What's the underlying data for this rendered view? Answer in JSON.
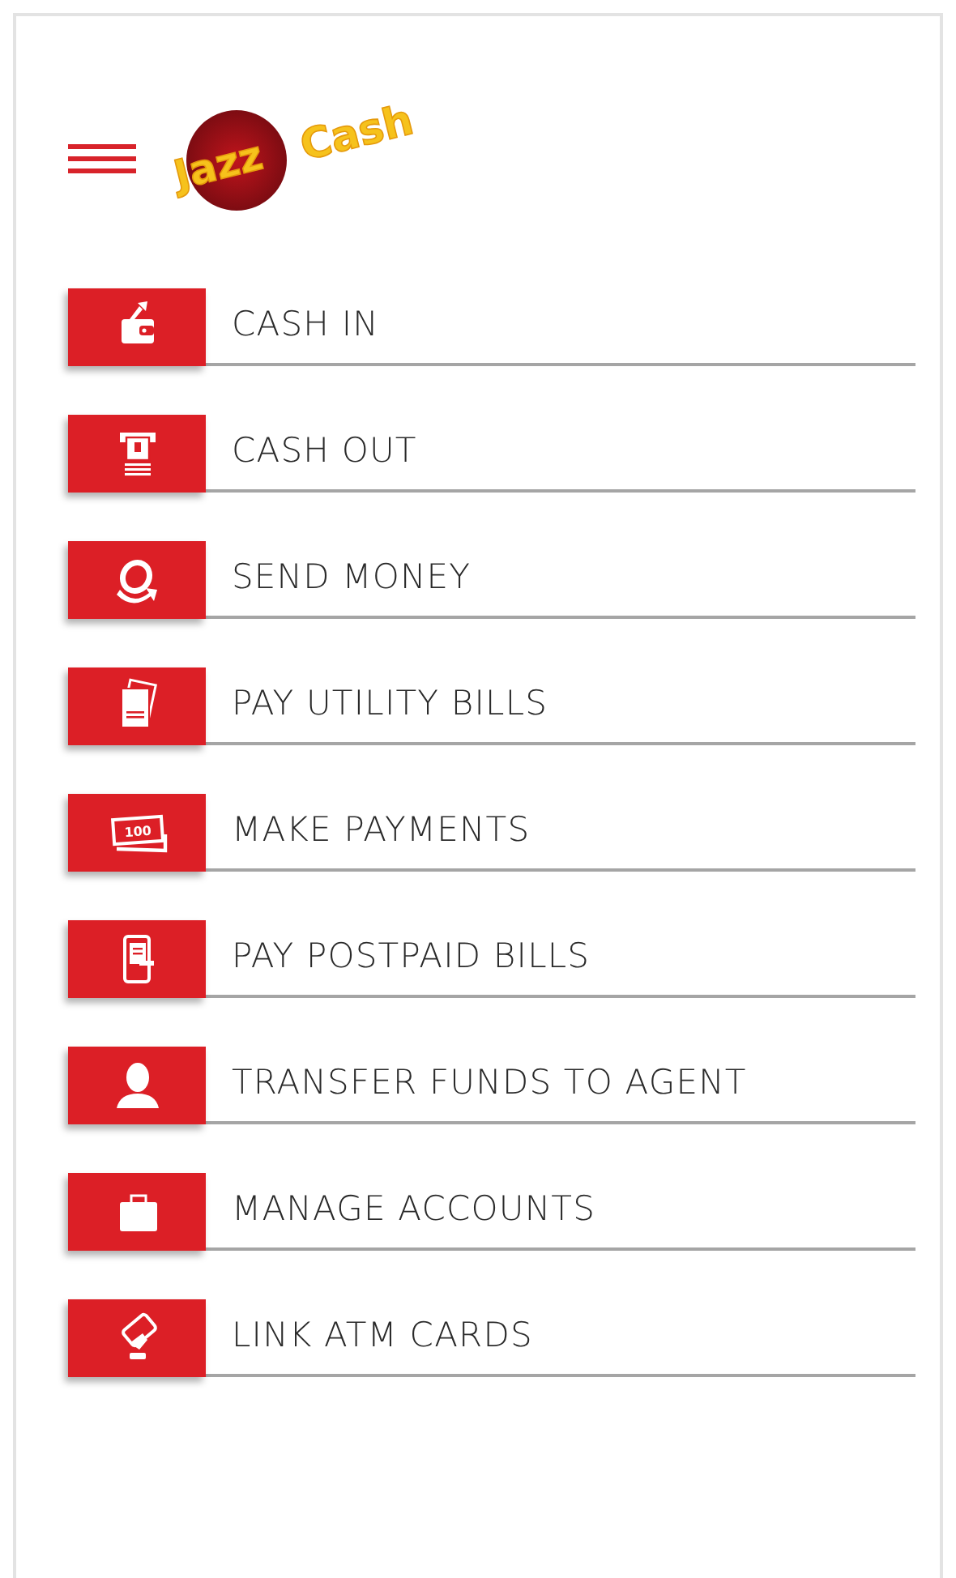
{
  "header": {
    "logo": {
      "part_1": "Jazz",
      "part_2": "Cash"
    }
  },
  "menu": [
    {
      "kind": "wallet",
      "label": "CASH IN"
    },
    {
      "kind": "atm",
      "label": "CASH OUT"
    },
    {
      "kind": "send",
      "label": "SEND MONEY"
    },
    {
      "kind": "bills",
      "label": "PAY UTILITY BILLS"
    },
    {
      "kind": "banknote",
      "label": "MAKE PAYMENTS",
      "icon_text": "100"
    },
    {
      "kind": "phone",
      "label": "PAY POSTPAID BILLS"
    },
    {
      "kind": "person",
      "label": "TRANSFER FUNDS TO AGENT"
    },
    {
      "kind": "briefcase",
      "label": "MANAGE ACCOUNTS"
    },
    {
      "kind": "card",
      "label": "LINK ATM CARDS"
    }
  ]
}
